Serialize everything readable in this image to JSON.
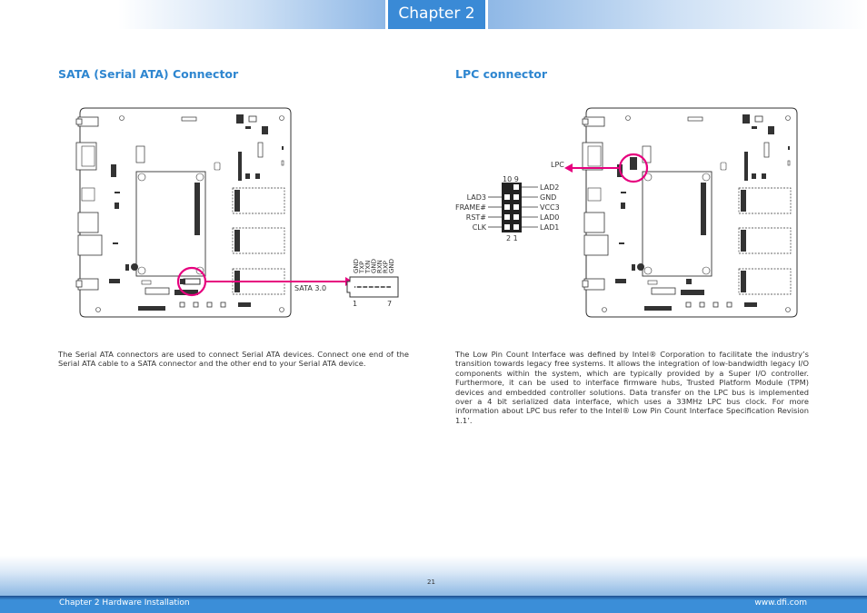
{
  "header": {
    "chapter_tab": "Chapter 2"
  },
  "sata": {
    "title": "SATA (Serial ATA) Connector",
    "connector_label": "SATA 3.0",
    "pin_labels": [
      "GND",
      "TXP",
      "TXN",
      "GND",
      "RXN",
      "RXP",
      "GND"
    ],
    "pin_start": "1",
    "pin_end": "7",
    "description": "The Serial ATA connectors are used to connect Serial ATA devices. Connect one end of the Serial ATA cable to a SATA connector and the other end to your Serial ATA device."
  },
  "lpc": {
    "title": "LPC connector",
    "callout_label": "LPC",
    "top_pins": "10  9",
    "bottom_pins": "2  1",
    "left_labels": [
      "LAD3",
      "FRAME#",
      "RST#",
      "CLK"
    ],
    "right_labels": [
      "LAD2",
      "GND",
      "VCC3",
      "LAD0",
      "LAD1"
    ],
    "description": "The Low Pin Count Interface was defined by Intel® Corporation to facilitate the industry’s transition towards legacy free systems. It allows the integration of low-bandwidth legacy I/O components within the system, which are typically provided by a Super I/O controller. Furthermore, it can be used to interface firmware hubs, Trusted Platform Module (TPM) devices and embedded controller solutions. Data transfer on the LPC bus is implemented over a 4 bit serialized data interface, which uses a 33MHz  LPC bus clock. For more information about LPC bus refer to the Intel® Low Pin Count  Interface Specification Revision 1.1’."
  },
  "colors": {
    "accent": "#2e86d0",
    "highlight": "#e6007e",
    "tab": "#3a8ad6"
  },
  "footer": {
    "page_number": "21",
    "left": "Chapter 2 Hardware Installation",
    "right": "www.dfi.com"
  }
}
